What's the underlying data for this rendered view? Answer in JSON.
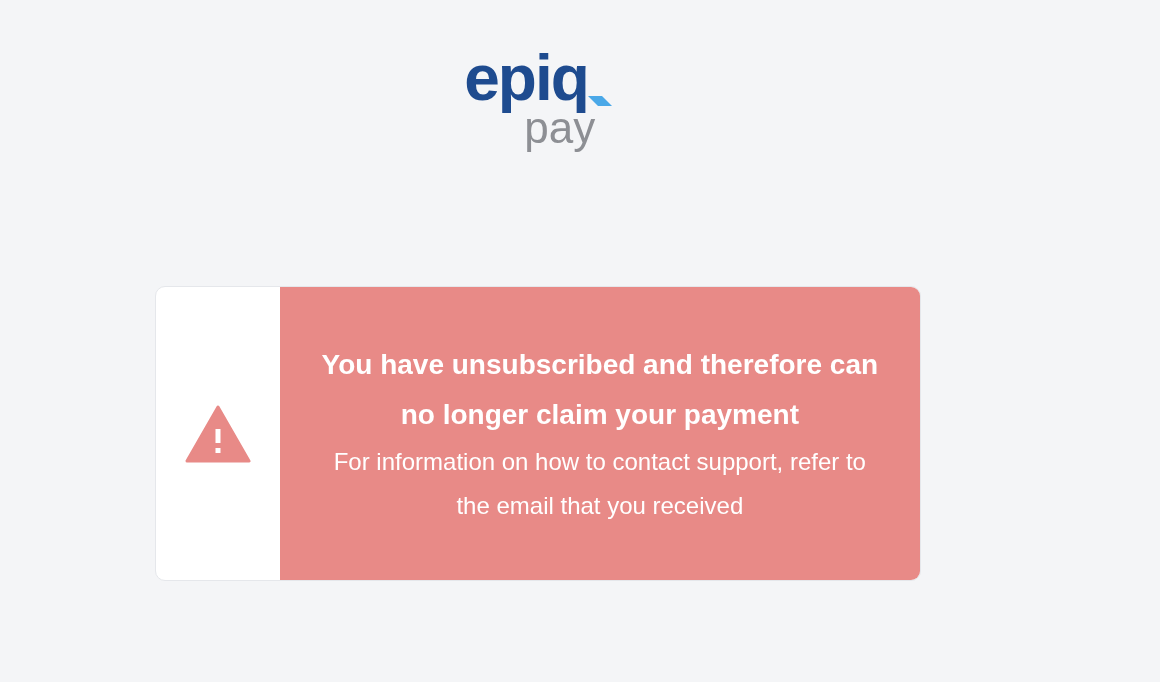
{
  "logo": {
    "brand": "epiq",
    "product": "pay"
  },
  "alert": {
    "title": "You have unsubscribed and therefore can no longer claim your payment",
    "message": "For information on how to contact support, refer to the email that you received"
  }
}
